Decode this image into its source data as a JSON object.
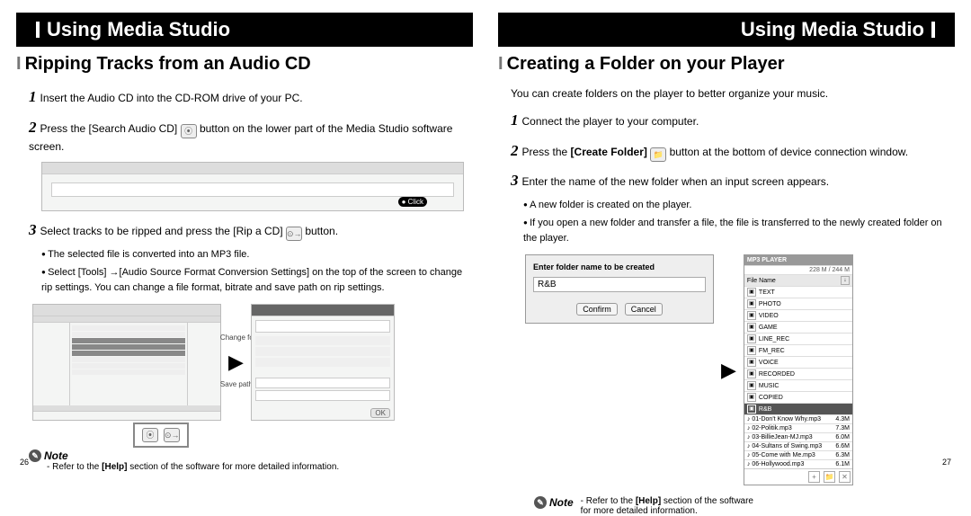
{
  "left": {
    "band": "Using Media Studio",
    "heading": "Ripping Tracks from an Audio CD",
    "steps": {
      "s1": "Insert the Audio CD into the CD-ROM drive of your PC.",
      "s2a": "Press the [Search Audio CD]",
      "s2b": "button on the lower part of the Media Studio software screen.",
      "s3a": "Select tracks to be ripped and press the [Rip a CD]",
      "s3b": "button."
    },
    "bullets": {
      "b1": "The selected file is converted into an MP3 file.",
      "b2": "Select [Tools] →[Audio Source Format Conversion Settings] on the top of the screen to change rip settings. You can change a file format, bitrate and save path on rip settings."
    },
    "figLabels": {
      "a": "Change format",
      "b": "Save path"
    },
    "click": "Click",
    "noteLabel": "Note",
    "noteText": "- Refer to the [Help] section of the software for more detailed information.",
    "noteHelp": "[Help]",
    "page": "26"
  },
  "right": {
    "band": "Using Media Studio",
    "heading": "Creating a Folder on your Player",
    "intro": "You can create folders on the player to better organize your music.",
    "steps": {
      "s1": "Connect the player to your computer.",
      "s2a": "Press the ",
      "s2bold": "[Create Folder]",
      "s2b": " button at the bottom of device connection window.",
      "s3": "Enter the name of the new folder when an input screen appears."
    },
    "bullets": {
      "b1": "A new folder is created on the player.",
      "b2": "If you open a new folder and transfer a file, the file is transferred to the newly created folder on the player."
    },
    "dialog": {
      "title": "Enter folder name to be created",
      "value": "R&B",
      "confirm": "Confirm",
      "cancel": "Cancel"
    },
    "device": {
      "head": "MP3 PLAYER",
      "cap": "228 M / 244 M",
      "colName": "File Name",
      "folders": [
        "TEXT",
        "PHOTO",
        "VIDEO",
        "GAME",
        "LINE_REC",
        "FM_REC",
        "VOICE",
        "RECORDED",
        "MUSIC",
        "COPIED"
      ],
      "selected": "R&B",
      "files": [
        {
          "n": "01-Don't Know Why.mp3",
          "s": "4.3M"
        },
        {
          "n": "02-Politik.mp3",
          "s": "7.3M"
        },
        {
          "n": "03-BillieJean-MJ.mp3",
          "s": "6.0M"
        },
        {
          "n": "04-Sultans of Swing.mp3",
          "s": "6.6M"
        },
        {
          "n": "05-Come with Me.mp3",
          "s": "6.3M"
        },
        {
          "n": "06-Hollywood.mp3",
          "s": "6.1M"
        }
      ]
    },
    "noteLabel": "Note",
    "noteLine1": "- Refer to the ",
    "noteHelp": "[Help]",
    "noteLine1b": " section of the software",
    "noteLine2": "for more detailed information.",
    "page": "27"
  }
}
